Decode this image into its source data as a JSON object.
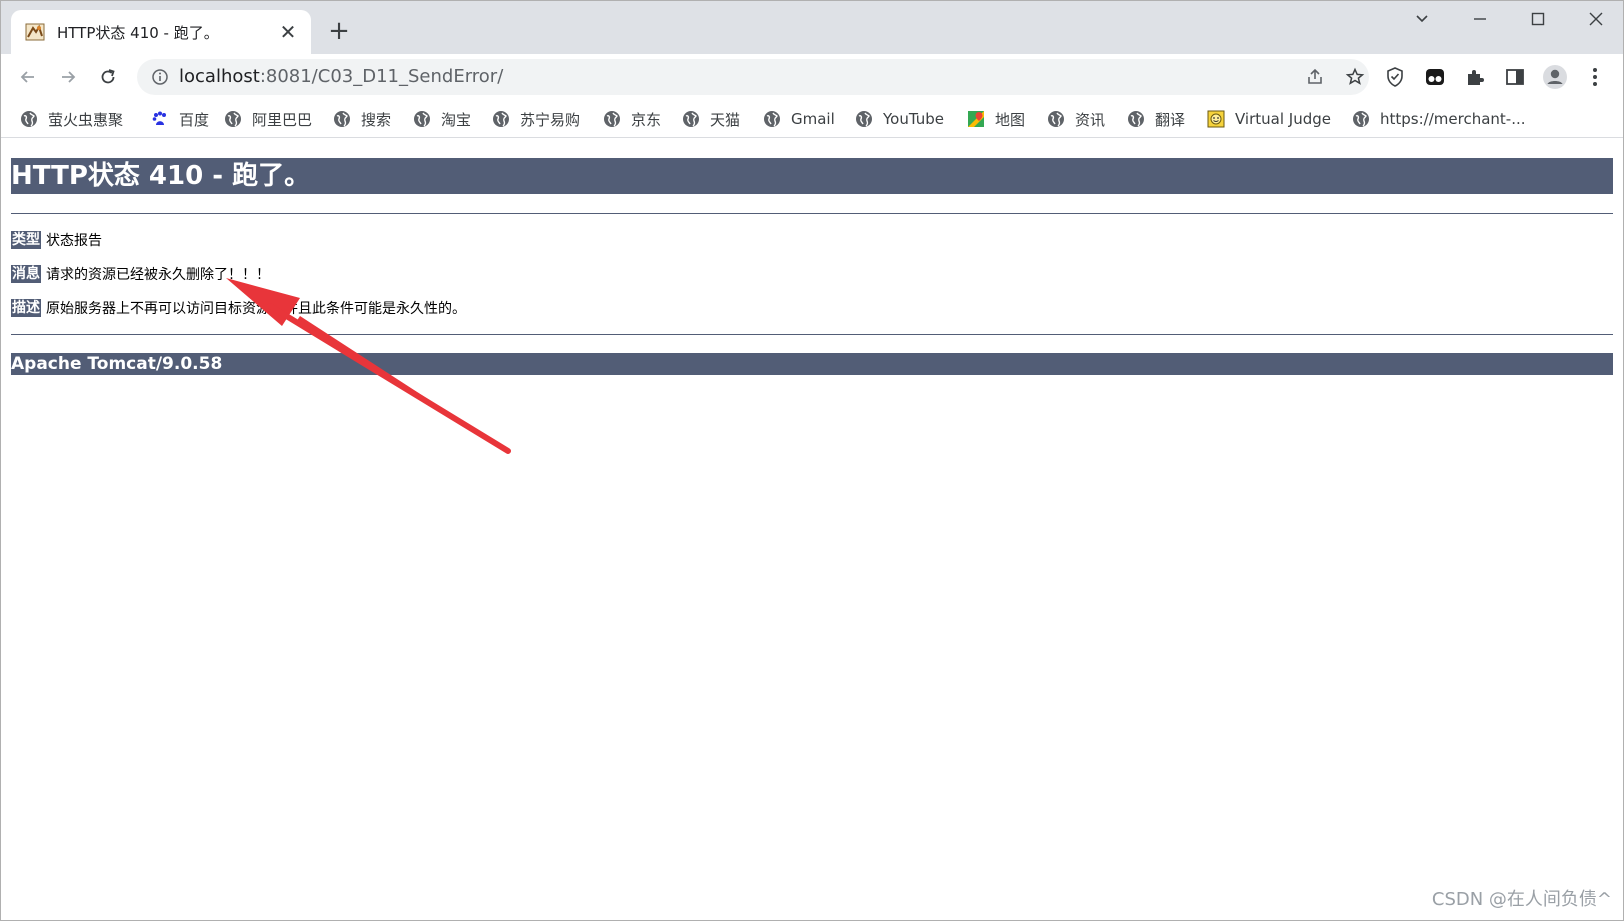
{
  "tab": {
    "title": "HTTP状态 410 - 跑了。",
    "close_glyph": "✕"
  },
  "newtab_glyph": "+",
  "omnibox": {
    "host": "localhost",
    "rest": ":8081/C03_D11_SendError/"
  },
  "bookmarks": [
    {
      "label": "萤火虫惠聚",
      "icon": "globe-icon"
    },
    {
      "label": "百度",
      "icon": "baidu-paw-icon"
    },
    {
      "label": "阿里巴巴",
      "icon": "globe-icon"
    },
    {
      "label": "搜索",
      "icon": "globe-icon"
    },
    {
      "label": "淘宝",
      "icon": "globe-icon"
    },
    {
      "label": "苏宁易购",
      "icon": "globe-icon"
    },
    {
      "label": "京东",
      "icon": "globe-icon"
    },
    {
      "label": "天猫",
      "icon": "globe-icon"
    },
    {
      "label": "Gmail",
      "icon": "globe-icon"
    },
    {
      "label": "YouTube",
      "icon": "globe-icon"
    },
    {
      "label": "地图",
      "icon": "maps-icon"
    },
    {
      "label": "资讯",
      "icon": "globe-icon"
    },
    {
      "label": "翻译",
      "icon": "globe-icon"
    },
    {
      "label": "Virtual Judge",
      "icon": "vjudge-icon"
    },
    {
      "label": "https://merchant-...",
      "icon": "globe-icon"
    }
  ],
  "page": {
    "heading": "HTTP状态 410 - 跑了。",
    "type_label": "类型",
    "type_value": "状态报告",
    "message_label": "消息",
    "message_value": "请求的资源已经被永久删除了！！！",
    "description_label": "描述",
    "description_value": "原始服务器上不再可以访问目标资源，并且此条件可能是永久性的。",
    "server_info": "Apache Tomcat/9.0.58"
  },
  "watermark": "CSDN @在人间负债^",
  "colors": {
    "tomcat_bar": "#525d76",
    "annotation_arrow": "#e8353a",
    "tab_strip": "#dee1e6"
  }
}
